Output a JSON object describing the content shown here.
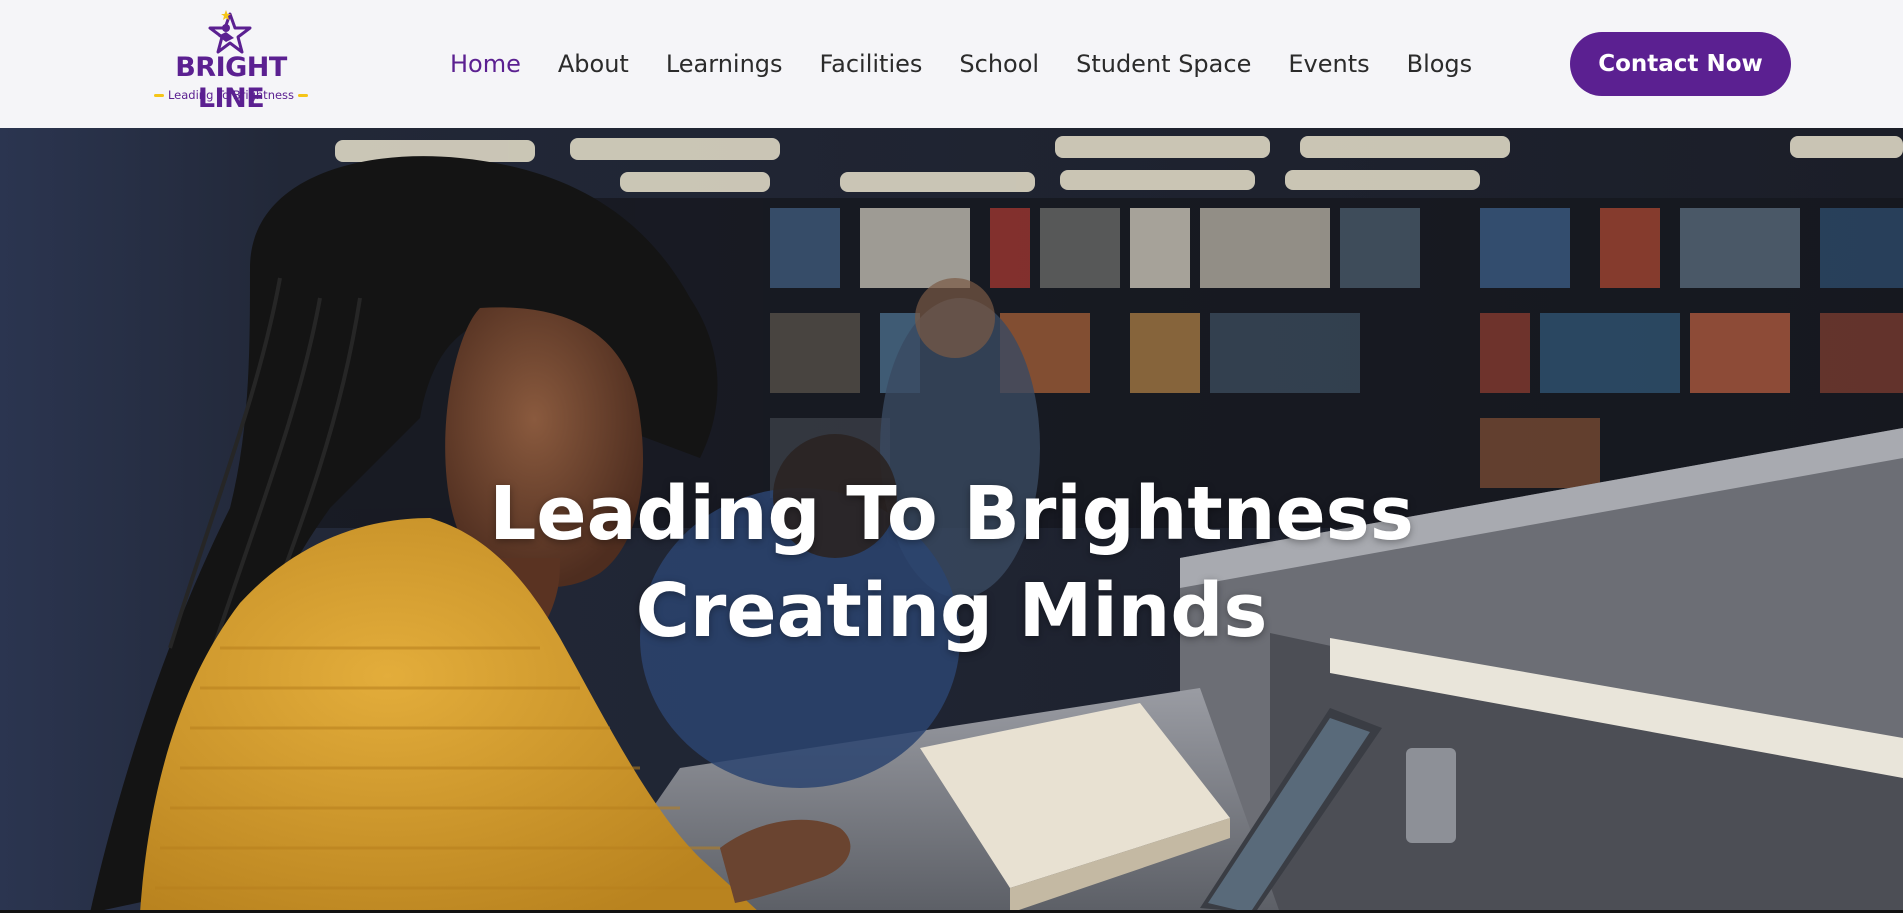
{
  "brand": {
    "name": "BRIGHT LINE",
    "tagline": "Leading To Brightness",
    "primary_color": "#5b2091",
    "accent_color": "#f5c518"
  },
  "nav": {
    "items": [
      {
        "label": "Home",
        "active": true
      },
      {
        "label": "About"
      },
      {
        "label": "Learnings"
      },
      {
        "label": "Facilities"
      },
      {
        "label": "School"
      },
      {
        "label": "Student Space"
      },
      {
        "label": "Events"
      },
      {
        "label": "Blogs"
      }
    ]
  },
  "cta": {
    "label": "Contact Now"
  },
  "hero": {
    "line1": "Leading To Brightness",
    "line2": "Creating Minds",
    "image": "student-reading-in-library-photo"
  }
}
